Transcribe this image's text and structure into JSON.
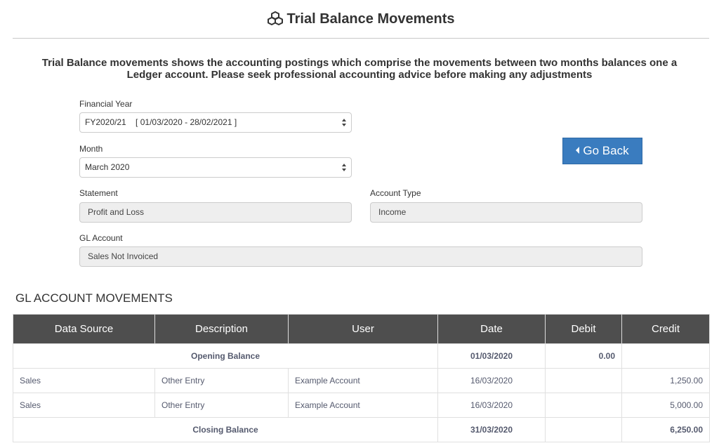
{
  "header": {
    "title": "Trial Balance Movements",
    "icon": "cubes-icon"
  },
  "intro": {
    "text": "Trial Balance movements shows the accounting postings which comprise the movements between two months balances one a Ledger account. Please seek professional accounting advice before making any adjustments"
  },
  "form": {
    "financial_year": {
      "label": "Financial Year",
      "value": "FY2020/21    [ 01/03/2020 - 28/02/2021 ]"
    },
    "month": {
      "label": "Month",
      "value": "March 2020"
    },
    "statement": {
      "label": "Statement",
      "value": "Profit and Loss"
    },
    "account_type": {
      "label": "Account Type",
      "value": "Income"
    },
    "gl_account": {
      "label": "GL Account",
      "value": "Sales Not Invoiced"
    }
  },
  "go_back": {
    "label": "Go Back",
    "color": "#3a7cbf"
  },
  "movements": {
    "title": "GL ACCOUNT MOVEMENTS",
    "columns": [
      "Data Source",
      "Description",
      "User",
      "Date",
      "Debit",
      "Credit"
    ],
    "opening": {
      "label": "Opening Balance",
      "date": "01/03/2020",
      "debit": "0.00",
      "credit": ""
    },
    "rows": [
      {
        "source": "Sales",
        "description": "Other Entry",
        "user": "Example Account",
        "date": "16/03/2020",
        "debit": "",
        "credit": "1,250.00"
      },
      {
        "source": "Sales",
        "description": "Other Entry",
        "user": "Example Account",
        "date": "16/03/2020",
        "debit": "",
        "credit": "5,000.00"
      }
    ],
    "closing": {
      "label": "Closing Balance",
      "date": "31/03/2020",
      "debit": "",
      "credit": "6,250.00"
    }
  }
}
